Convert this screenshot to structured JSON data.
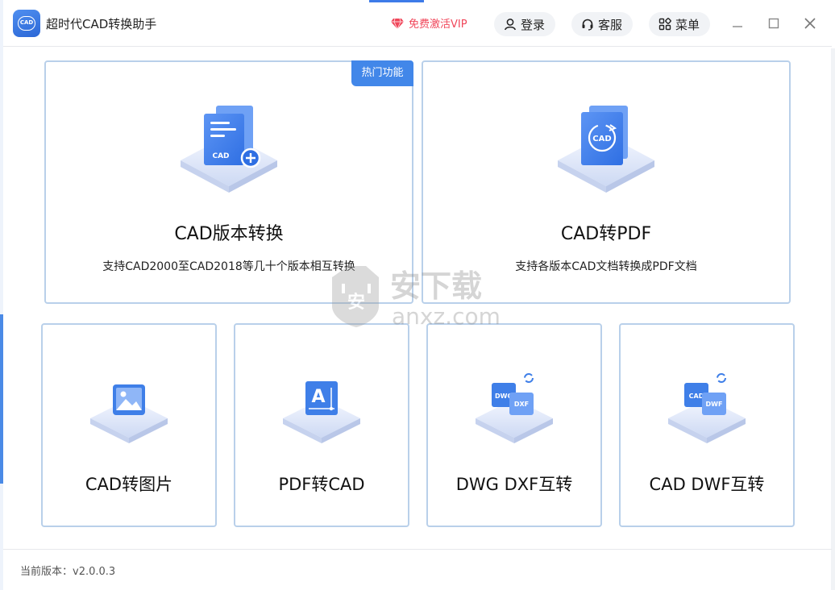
{
  "app": {
    "title": "超时代CAD转换助手",
    "logo_text": "CAD"
  },
  "header": {
    "vip_label": "免费激活VIP",
    "login_label": "登录",
    "service_label": "客服",
    "menu_label": "菜单"
  },
  "cards": {
    "version_convert": {
      "title": "CAD版本转换",
      "desc": "支持CAD2000至CAD2018等几十个版本相互转换",
      "badge": "热门功能",
      "icon_text": "CAD"
    },
    "cad_to_pdf": {
      "title": "CAD转PDF",
      "desc": "支持各版本CAD文档转换成PDF文档",
      "icon_text": "CAD"
    },
    "cad_to_image": {
      "title": "CAD转图片"
    },
    "pdf_to_cad": {
      "title": "PDF转CAD",
      "icon_text": "A"
    },
    "dwg_dxf": {
      "title": "DWG DXF互转",
      "icon_text_a": "DWG",
      "icon_text_b": "DXF"
    },
    "cad_dwf": {
      "title": "CAD DWF互转",
      "icon_text_a": "CAD",
      "icon_text_b": "DWF"
    }
  },
  "footer": {
    "version_label": "当前版本：v2.0.0.3"
  },
  "watermark": {
    "cn": "安下载",
    "en": "anxz.com"
  },
  "colors": {
    "accent": "#4287e9",
    "card_border": "#b9d0ea",
    "vip": "#f0465a"
  }
}
